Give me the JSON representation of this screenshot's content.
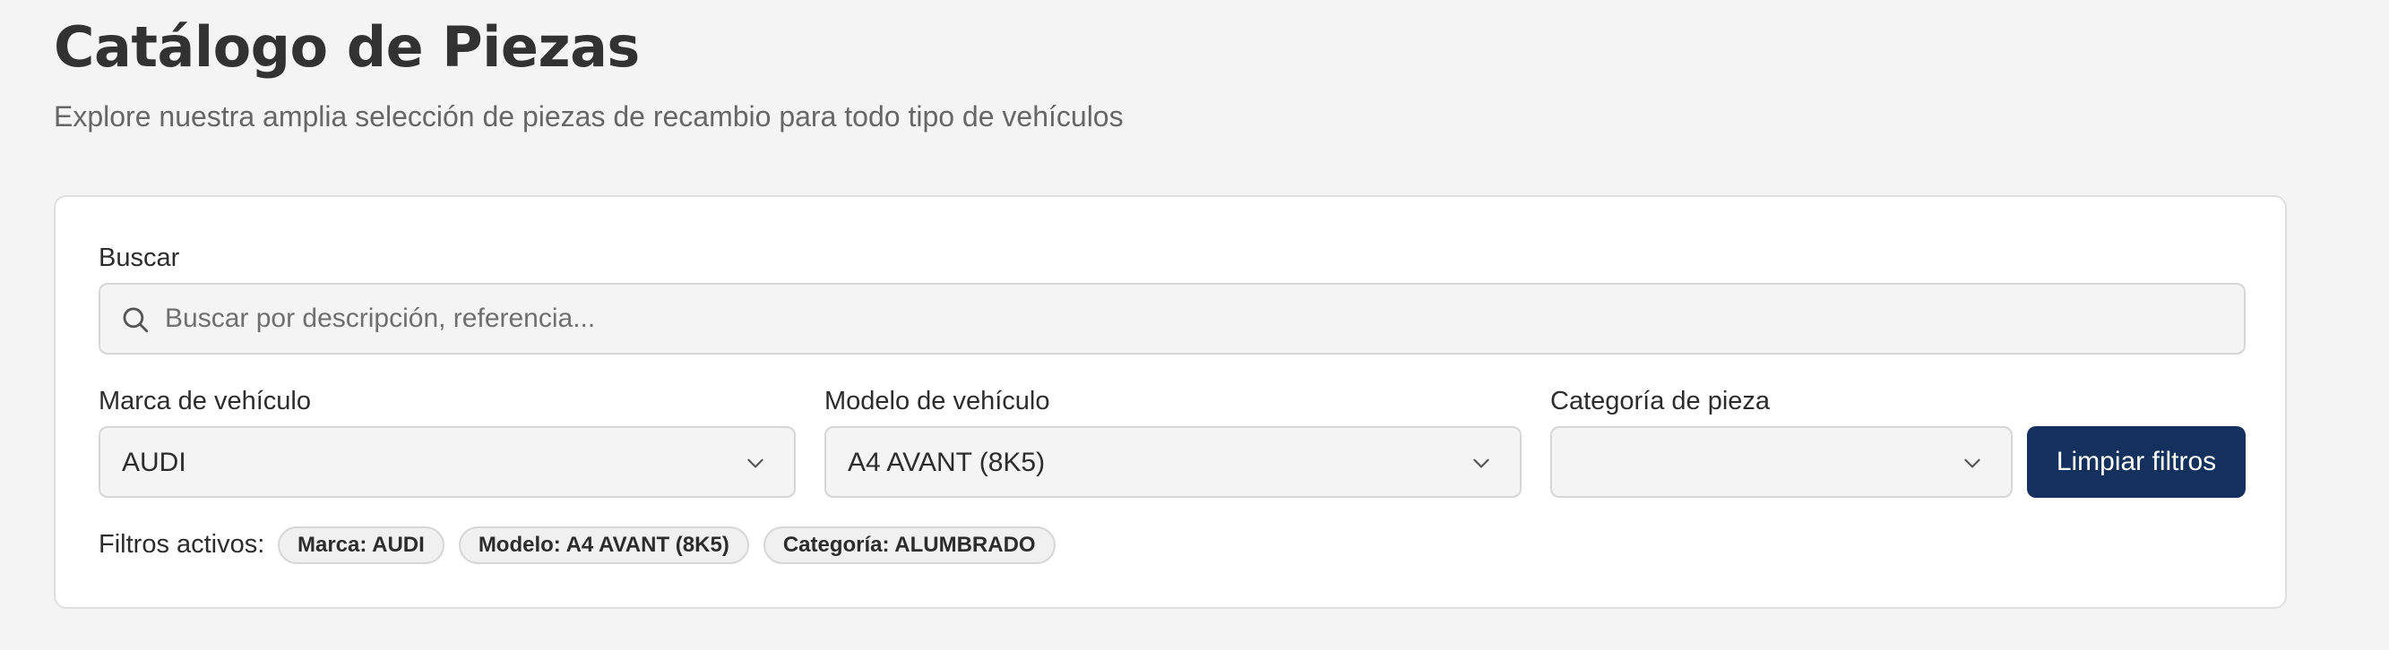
{
  "header": {
    "title": "Catálogo de Piezas",
    "subtitle": "Explore nuestra amplia selección de piezas de recambio para todo tipo de vehículos"
  },
  "filters": {
    "search": {
      "label": "Buscar",
      "placeholder": "Buscar por descripción, referencia...",
      "value": "",
      "icon": "search-icon"
    },
    "brand": {
      "label": "Marca de vehículo",
      "value": "AUDI",
      "icon": "chevron-down-icon"
    },
    "model": {
      "label": "Modelo de vehículo",
      "value": "A4 AVANT (8K5)",
      "icon": "chevron-down-icon"
    },
    "category": {
      "label": "Categoría de pieza",
      "value": "",
      "icon": "chevron-down-icon"
    },
    "clear_label": "Limpiar filtros",
    "active_label": "Filtros activos:",
    "active_chips": [
      "Marca: AUDI",
      "Modelo: A4 AVANT (8K5)",
      "Categoría: ALUMBRADO"
    ]
  },
  "colors": {
    "background": "#f4f4f4",
    "card": "#ffffff",
    "accent": "#13315c",
    "title": "#323232",
    "subtitle": "#666666"
  }
}
